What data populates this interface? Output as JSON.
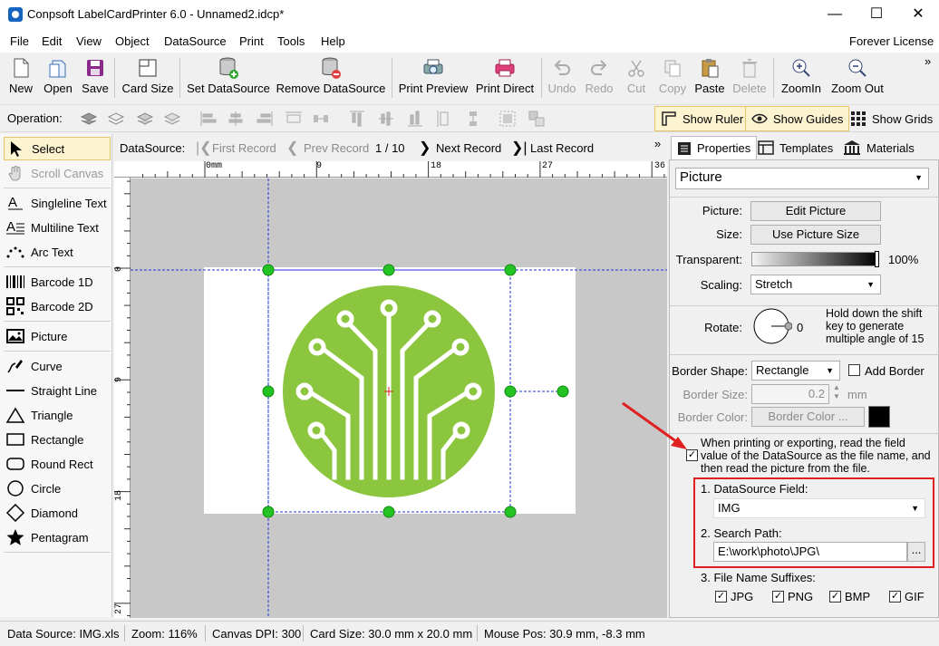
{
  "window": {
    "title": "Conpsoft LabelCardPrinter 6.0 - Unnamed2.idcp*",
    "minimize": "—",
    "maximize": "☐",
    "close": "✕"
  },
  "menu": {
    "items": [
      "File",
      "Edit",
      "View",
      "Object",
      "DataSource",
      "Print",
      "Tools",
      "Help"
    ],
    "license": "Forever License"
  },
  "toolbar": {
    "new": "New",
    "open": "Open",
    "save": "Save",
    "card_size": "Card Size",
    "set_datasource": "Set DataSource",
    "remove_datasource": "Remove DataSource",
    "print_preview": "Print Preview",
    "print_direct": "Print Direct",
    "undo": "Undo",
    "redo": "Redo",
    "cut": "Cut",
    "copy": "Copy",
    "paste": "Paste",
    "delete": "Delete",
    "zoom_in": "ZoomIn",
    "zoom_out": "Zoom Out",
    "overflow": "»"
  },
  "operation": {
    "label": "Operation:",
    "show_ruler": "Show Ruler",
    "show_guides": "Show Guides",
    "show_grids": "Show Grids"
  },
  "tools": {
    "select": "Select",
    "scroll_canvas": "Scroll Canvas",
    "singleline_text": "Singleline Text",
    "multiline_text": "Multiline Text",
    "arc_text": "Arc Text",
    "barcode_1d": "Barcode 1D",
    "barcode_2d": "Barcode 2D",
    "picture": "Picture",
    "curve": "Curve",
    "straight_line": "Straight Line",
    "triangle": "Triangle",
    "rectangle": "Rectangle",
    "round_rect": "Round Rect",
    "circle": "Circle",
    "diamond": "Diamond",
    "pentagram": "Pentagram"
  },
  "datasource_nav": {
    "label": "DataSource:",
    "first": "First Record",
    "prev": "Prev Record",
    "position": "1 / 10",
    "next": "Next Record",
    "last": "Last Record",
    "overflow": "»"
  },
  "rulers": {
    "h_ticks": [
      "0mm",
      "9",
      "18",
      "27",
      "36"
    ],
    "v_ticks": [
      "0",
      "9",
      "18",
      "27"
    ]
  },
  "properties": {
    "tabs": [
      "Properties",
      "Templates",
      "Materials"
    ],
    "object_type": "Picture",
    "picture_label": "Picture:",
    "edit_picture": "Edit Picture",
    "size_label": "Size:",
    "use_picture_size": "Use Picture Size",
    "transparent_label": "Transparent:",
    "transparent_value": "100%",
    "scaling_label": "Scaling:",
    "scaling_value": "Stretch",
    "rotate_label": "Rotate:",
    "rotate_value": "0",
    "rotate_hint": "Hold down the shift key to generate multiple angle of 15",
    "border_shape_label": "Border Shape:",
    "border_shape_value": "Rectangle",
    "add_border": "Add Border",
    "border_size_label": "Border Size:",
    "border_size_value": "0.2",
    "border_size_unit": "mm",
    "border_color_label": "Border Color:",
    "border_color_button": "Border Color ...",
    "border_color_swatch": "#000000",
    "datasource_note": "When printing or exporting, read the field value of the DataSource as the file name, and then read the picture from the file.",
    "datasource_field_label": "1. DataSource Field:",
    "datasource_field_value": "IMG",
    "search_path_label": "2. Search Path:",
    "search_path_value": "E:\\work\\photo\\JPG\\",
    "browse": "...",
    "suffix_label": "3. File Name Suffixes:",
    "suffixes": [
      "JPG",
      "PNG",
      "BMP",
      "GIF"
    ]
  },
  "status": {
    "data_source": "Data Source: IMG.xls",
    "zoom": "Zoom: 116%",
    "dpi": "Canvas DPI: 300",
    "card_size": "Card Size: 30.0 mm x 20.0 mm",
    "mouse_pos": "Mouse Pos: 30.9 mm, -8.3 mm"
  },
  "colors": {
    "logo_green": "#8cc63f",
    "highlight_red": "#e02020",
    "selection_handle": "#22c322",
    "guide_blue": "#2233dd"
  }
}
